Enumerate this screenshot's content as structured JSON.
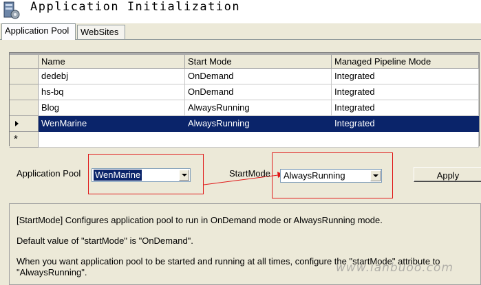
{
  "window": {
    "title": "Application Initialization",
    "icon": "server-gear-icon"
  },
  "tabs": [
    {
      "label": "Application Pool",
      "active": true
    },
    {
      "label": "WebSites",
      "active": false
    }
  ],
  "grid": {
    "columns": [
      "Name",
      "Start Mode",
      "Managed Pipeline Mode"
    ],
    "rows": [
      {
        "name": "dedebj",
        "start_mode": "OnDemand",
        "pipeline": "Integrated"
      },
      {
        "name": "hs-bq",
        "start_mode": "OnDemand",
        "pipeline": "Integrated"
      },
      {
        "name": "Blog",
        "start_mode": "AlwaysRunning",
        "pipeline": "Integrated"
      },
      {
        "name": "WenMarine",
        "start_mode": "AlwaysRunning",
        "pipeline": "Integrated",
        "selected": true
      }
    ],
    "new_row_marker": "*"
  },
  "form": {
    "app_pool_label": "Application Pool",
    "app_pool_value": "WenMarine",
    "start_mode_label": "StartMode",
    "start_mode_value": "AlwaysRunning",
    "apply_label": "Apply"
  },
  "description": {
    "line1": "[StartMode] Configures application pool to run in OnDemand mode or AlwaysRunning mode.",
    "line2": "Default value of \"startMode\" is \"OnDemand\".",
    "line3": "When you want application pool to be started and running at all times, configure the \"startMode\" attribute to \"AlwaysRunning\"."
  },
  "watermark": "www.ianbuoo.com",
  "colors": {
    "selection": "#0a246a",
    "annotation": "#e01818",
    "background": "#ece9d8"
  }
}
